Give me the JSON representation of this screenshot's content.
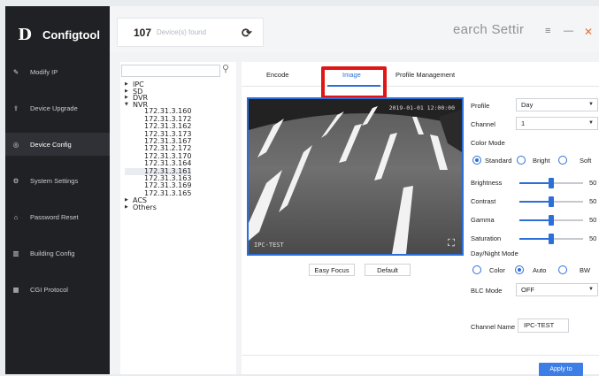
{
  "app": {
    "name": "Configtool",
    "logo_glyph": "D"
  },
  "sidebar": {
    "items": [
      {
        "label": "Modify IP",
        "icon": "edit-icon",
        "glyph": "✎",
        "active": false
      },
      {
        "label": "Device Upgrade",
        "icon": "upgrade-icon",
        "glyph": "⇪",
        "active": false
      },
      {
        "label": "Device Config",
        "icon": "settings-icon",
        "glyph": "◎",
        "active": true
      },
      {
        "label": "System Settings",
        "icon": "gear-icon",
        "glyph": "⚙",
        "active": false
      },
      {
        "label": "Password Reset",
        "icon": "lock-icon",
        "glyph": "⌂",
        "active": false
      },
      {
        "label": "Building Config",
        "icon": "building-icon",
        "glyph": "▥",
        "active": false
      },
      {
        "label": "CGI Protocol",
        "icon": "grid-icon",
        "glyph": "▦",
        "active": false
      }
    ]
  },
  "topbar": {
    "device_count": "107",
    "device_count_label": "Device(s) found",
    "refresh_glyph": "⟳",
    "search_text": "earch Settir",
    "filter_glyph": "≡",
    "minimize_glyph": "—",
    "close_glyph": "✕"
  },
  "tree": {
    "search_value": "",
    "nodes": [
      {
        "label": "IPC",
        "caret": "▶"
      },
      {
        "label": "SD",
        "caret": "▶"
      },
      {
        "label": "DVR",
        "caret": "▶"
      },
      {
        "label": "NVR",
        "caret": "▼"
      }
    ],
    "ips": [
      "172.31.3.160",
      "172.31.3.172",
      "172.31.3.162",
      "172.31.3.173",
      "172.31.3.167",
      "172.31.2.172",
      "172.31.3.170",
      "172.31.3.164",
      "172.31.3.161",
      "172.31.3.163",
      "172.31.3.169",
      "172.31.3.165"
    ],
    "selected_ip": "172.31.3.161",
    "tail_nodes": [
      {
        "label": "ACS",
        "caret": "▶"
      },
      {
        "label": "Others",
        "caret": "▶"
      }
    ]
  },
  "tabs": [
    {
      "label": "Encode",
      "active": false
    },
    {
      "label": "Image",
      "active": true
    },
    {
      "label": "Profile Management",
      "active": false
    }
  ],
  "preview": {
    "timestamp_left": "IPC-TEST",
    "timestamp_right": "2019-01-01 12:00:00",
    "expand_glyph": "⛶"
  },
  "preview_buttons": {
    "easy_focus": "Easy Focus",
    "default": "Default"
  },
  "settings": {
    "profile_label": "Profile",
    "profile_value": "Day",
    "channel_label": "Channel",
    "channel_value": "1",
    "color_mode_label": "Color Mode",
    "color_modes": [
      "Standard",
      "Bright",
      "Soft"
    ],
    "color_mode_selected": "Standard",
    "sliders": [
      {
        "label": "Brightness",
        "value": 50,
        "max": 100
      },
      {
        "label": "Contrast",
        "value": 50,
        "max": 100
      },
      {
        "label": "Gamma",
        "value": 50,
        "max": 100
      },
      {
        "label": "Saturation",
        "value": 50,
        "max": 100
      }
    ],
    "day_night_label": "Day/Night Mode",
    "day_night_options": [
      "Color",
      "Auto",
      "BW"
    ],
    "day_night_selected": "Auto",
    "blc_label": "BLC Mode",
    "blc_value": "OFF",
    "channel_name_label": "Channel Name",
    "channel_name_value": "IPC-TEST",
    "apply_label": "Apply to"
  },
  "colors": {
    "accent": "#2d6fd9",
    "highlight": "#e01616",
    "sidebar": "#1f2124"
  }
}
